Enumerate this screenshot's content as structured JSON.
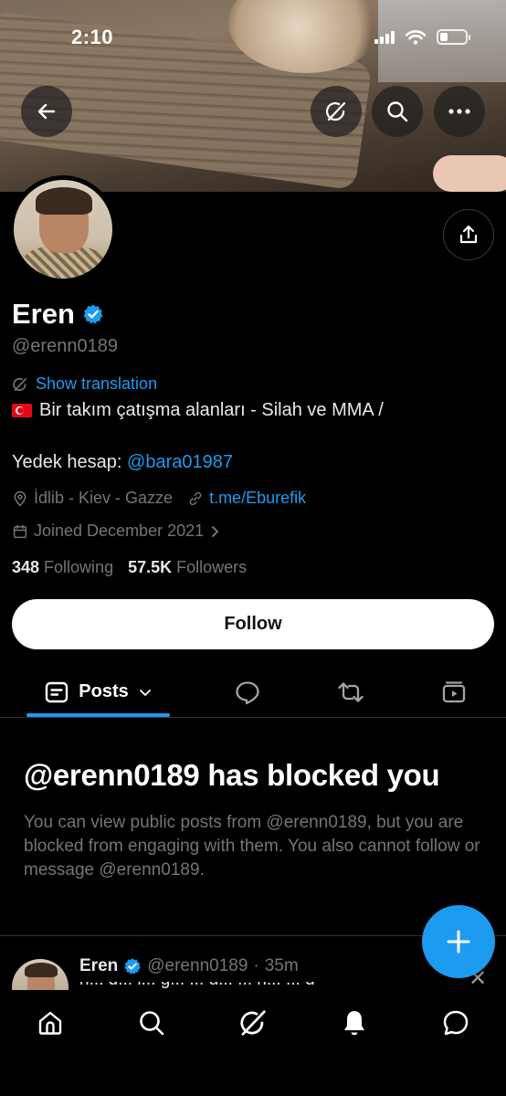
{
  "status_bar": {
    "time": "2:10"
  },
  "profile": {
    "name": "Eren",
    "handle": "@erenn0189",
    "show_translation": "Show translation",
    "bio_line1": "Bir takım çatışma alanları - Silah ve MMA /",
    "bio_line2_prefix": "Yedek hesap: ",
    "bio_mention": "@bara01987",
    "location": "İdlib - Kiev - Gazze",
    "link": "t.me/Eburefik",
    "joined": "Joined December 2021",
    "following_count": "348",
    "following_label": "Following",
    "followers_count": "57.5K",
    "followers_label": "Followers",
    "follow_button": "Follow"
  },
  "tabs": {
    "posts_label": "Posts"
  },
  "blocked": {
    "title": "@erenn0189 has blocked you",
    "body": "You can view public posts from @erenn0189, but you are blocked from engaging with them. You also cannot follow or message @erenn0189."
  },
  "post_preview": {
    "name": "Eren",
    "handle": "@erenn0189",
    "separator": "·",
    "time": "35m",
    "snippet": "n... d... l... ğ... ... ü... ... h... ... d"
  },
  "colors": {
    "accent": "#1d9bf0",
    "background": "#000000",
    "muted": "#71767b"
  },
  "icons": [
    "back-arrow-icon",
    "grok-icon",
    "search-icon",
    "more-icon",
    "share-icon",
    "verified-badge-icon",
    "translate-icon",
    "location-icon",
    "link-icon",
    "calendar-icon",
    "chevron-right-icon",
    "posts-icon",
    "chevron-down-icon",
    "replies-icon",
    "reposts-icon",
    "media-icon",
    "plus-icon",
    "home-icon",
    "notifications-icon",
    "messages-icon",
    "close-icon"
  ]
}
